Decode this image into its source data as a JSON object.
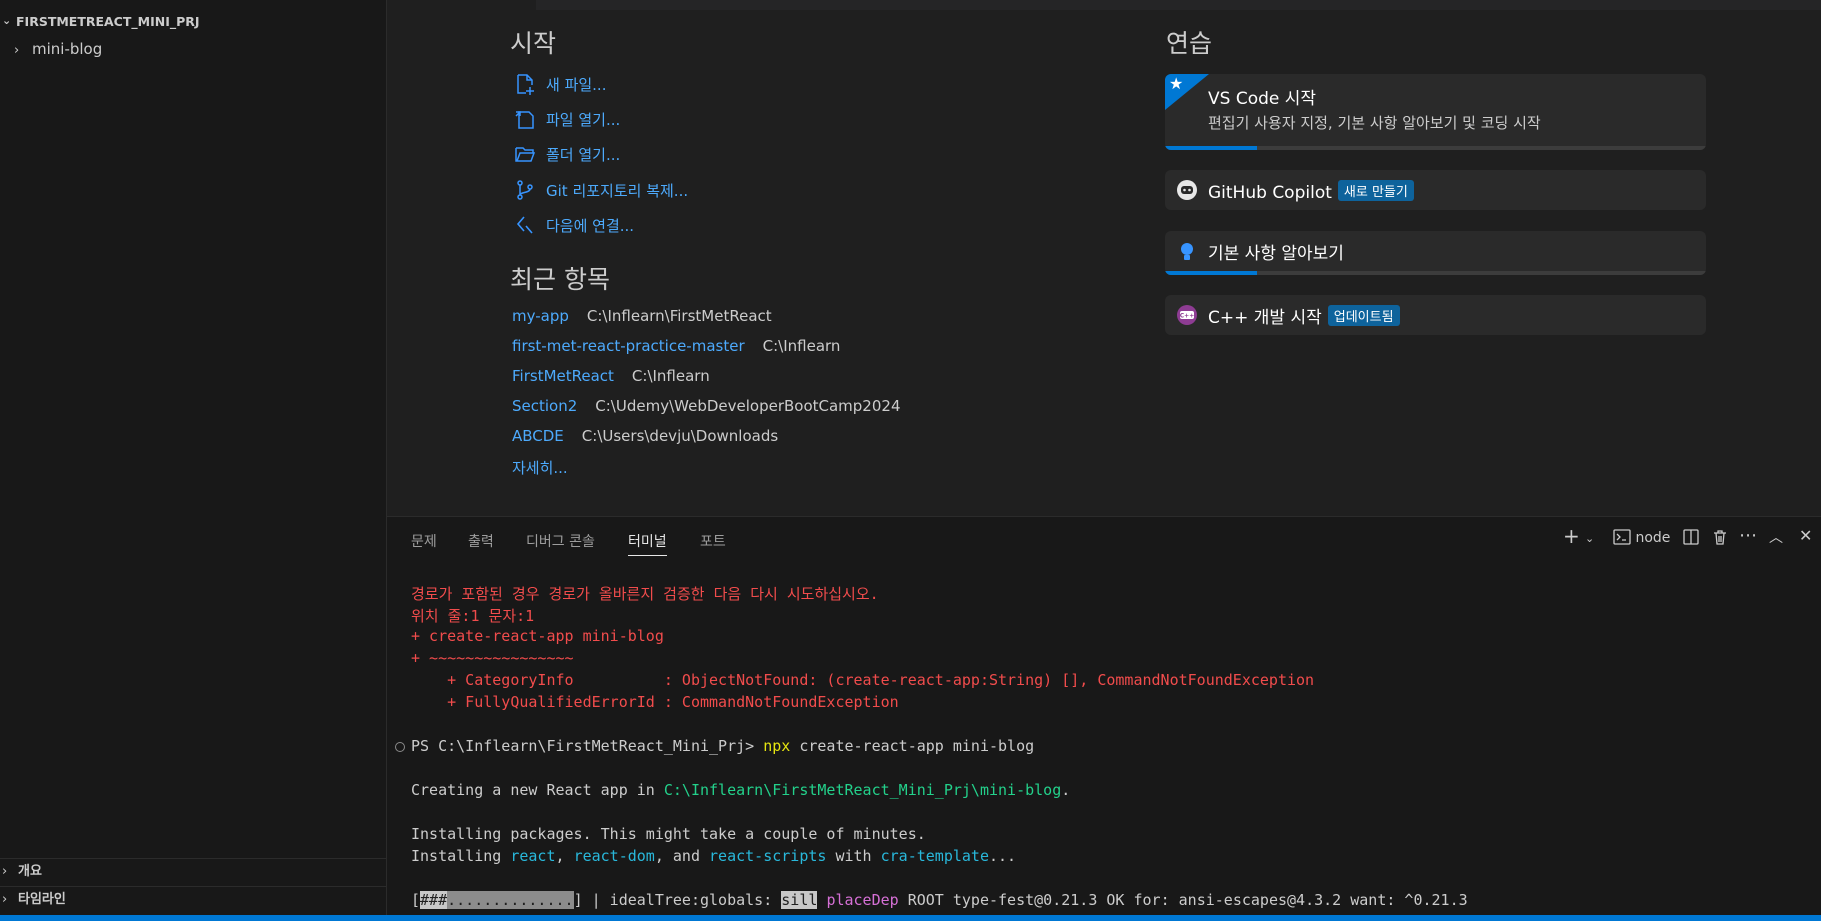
{
  "sidebar": {
    "root_folder": "FIRSTMETREACT_MINI_PRJ",
    "items": [
      {
        "label": "mini-blog"
      }
    ],
    "sections": [
      {
        "label": "개요"
      },
      {
        "label": "타임라인"
      }
    ]
  },
  "welcome": {
    "start_heading": "시작",
    "start_items": [
      {
        "label": "새 파일...",
        "icon": "new-file-icon"
      },
      {
        "label": "파일 열기...",
        "icon": "open-file-icon"
      },
      {
        "label": "폴더 열기...",
        "icon": "open-folder-icon"
      },
      {
        "label": "Git 리포지토리 복제...",
        "icon": "git-branch-icon"
      },
      {
        "label": "다음에 연결...",
        "icon": "remote-connect-icon"
      }
    ],
    "recent_heading": "최근 항목",
    "recent": [
      {
        "name": "my-app",
        "path": "C:\\Inflearn\\FirstMetReact"
      },
      {
        "name": "first-met-react-practice-master",
        "path": "C:\\Inflearn"
      },
      {
        "name": "FirstMetReact",
        "path": "C:\\Inflearn"
      },
      {
        "name": "Section2",
        "path": "C:\\Udemy\\WebDeveloperBootCamp2024"
      },
      {
        "name": "ABCDE",
        "path": "C:\\Users\\devju\\Downloads"
      }
    ],
    "more_label": "자세히...",
    "walkthrough_heading": "연습",
    "walkthroughs": [
      {
        "title": "VS Code 시작",
        "description": "편집기 사용자 지정, 기본 사항 알아보기 및 코딩 시작",
        "progress": 0.17
      },
      {
        "title": "GitHub Copilot",
        "badge": "새로 만들기"
      },
      {
        "title": "기본 사항 알아보기",
        "progress": 0.17
      },
      {
        "title": "C++ 개발 시작",
        "badge": "업데이트됨"
      }
    ]
  },
  "panel": {
    "tabs": [
      {
        "label": "문제"
      },
      {
        "label": "출력"
      },
      {
        "label": "디버그 콘솔"
      },
      {
        "label": "터미널"
      },
      {
        "label": "포트"
      }
    ],
    "active_tab": "터미널",
    "terminal_name": "node"
  },
  "terminal": {
    "err1": "경로가 포함된 경우 경로가 올바른지 검증한 다음 다시 시도하십시오.",
    "err2": "위치 줄:1 문자:1",
    "err3": "+ create-react-app mini-blog",
    "err4": "+ ~~~~~~~~~~~~~~~~",
    "err5": "    + CategoryInfo          : ObjectNotFound: (create-react-app:String) [], CommandNotFoundException",
    "err6": "    + FullyQualifiedErrorId : CommandNotFoundException",
    "prompt": "PS C:\\Inflearn\\FirstMetReact_Mini_Prj> ",
    "cmd_npx": "npx",
    "cmd_rest": " create-react-app mini-blog",
    "creating_pre": "Creating a new React app in ",
    "creating_path": "C:\\Inflearn\\FirstMetReact_Mini_Prj\\mini-blog",
    "creating_post": ".",
    "installing1": "Installing packages. This might take a couple of minutes.",
    "inst_pre": "Installing ",
    "pkg1": "react",
    "sep1": ", ",
    "pkg2": "react-dom",
    "sep2": ", and ",
    "pkg3": "react-scripts",
    "sep3": " with ",
    "pkg4": "cra-template",
    "sep4": "...",
    "prog_open": "[",
    "prog_done": "###",
    "prog_rest": "..............",
    "prog_close": "] | idealTree:globals: ",
    "prog_sill": "sill",
    "prog_space": " ",
    "prog_place": "placeDep",
    "prog_tail": " ROOT type-fest@0.21.3 OK for: ansi-escapes@4.3.2 want: ^0.21.3"
  }
}
